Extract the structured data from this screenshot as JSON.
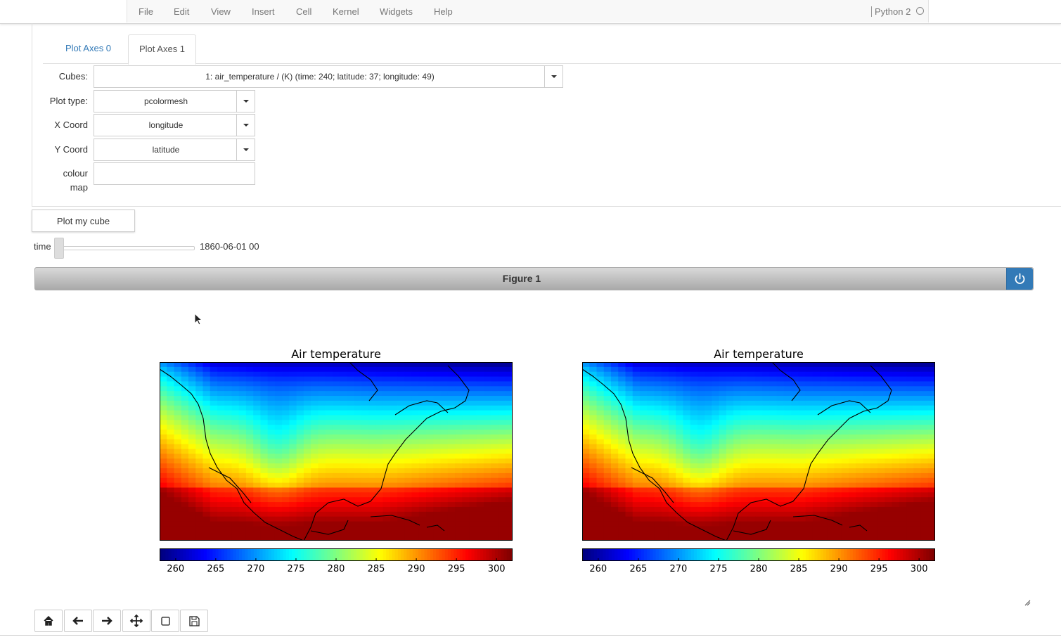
{
  "menubar": {
    "items": [
      "File",
      "Edit",
      "View",
      "Insert",
      "Cell",
      "Kernel",
      "Widgets",
      "Help"
    ],
    "kernel": "Python 2"
  },
  "tabs": [
    "Plot Axes 0",
    "Plot Axes 1"
  ],
  "form": {
    "cubes_label": "Cubes:",
    "cubes_value": "1: air_temperature / (K) (time: 240; latitude: 37; longitude: 49)",
    "plot_type_label": "Plot type:",
    "plot_type_value": "pcolormesh",
    "x_coord_label": "X Coord",
    "x_coord_value": "longitude",
    "y_coord_label": "Y Coord",
    "y_coord_value": "latitude",
    "colour_map_label_1": "colour",
    "colour_map_label_2": "map",
    "colour_map_value": ""
  },
  "plot_button": "Plot my cube",
  "time": {
    "label": "time",
    "value": "1860-06-01 00"
  },
  "figure": {
    "title": "Figure 1"
  },
  "chart_data": [
    {
      "type": "heatmap",
      "title": "Air temperature",
      "colorbar_ticks": [
        260,
        265,
        270,
        275,
        280,
        285,
        290,
        295,
        300
      ],
      "colorbar_range": [
        258,
        302
      ],
      "colormap": "jet"
    },
    {
      "type": "heatmap",
      "title": "Air temperature",
      "colorbar_ticks": [
        260,
        265,
        270,
        275,
        280,
        285,
        290,
        295,
        300
      ],
      "colorbar_range": [
        258,
        302
      ],
      "colormap": "jet"
    }
  ],
  "toolbar_icons": [
    "home-icon",
    "back-arrow-icon",
    "forward-arrow-icon",
    "move-icon",
    "zoom-rect-icon",
    "save-icon"
  ],
  "colors": {
    "link": "#337ab7",
    "power": "#337ab7"
  }
}
